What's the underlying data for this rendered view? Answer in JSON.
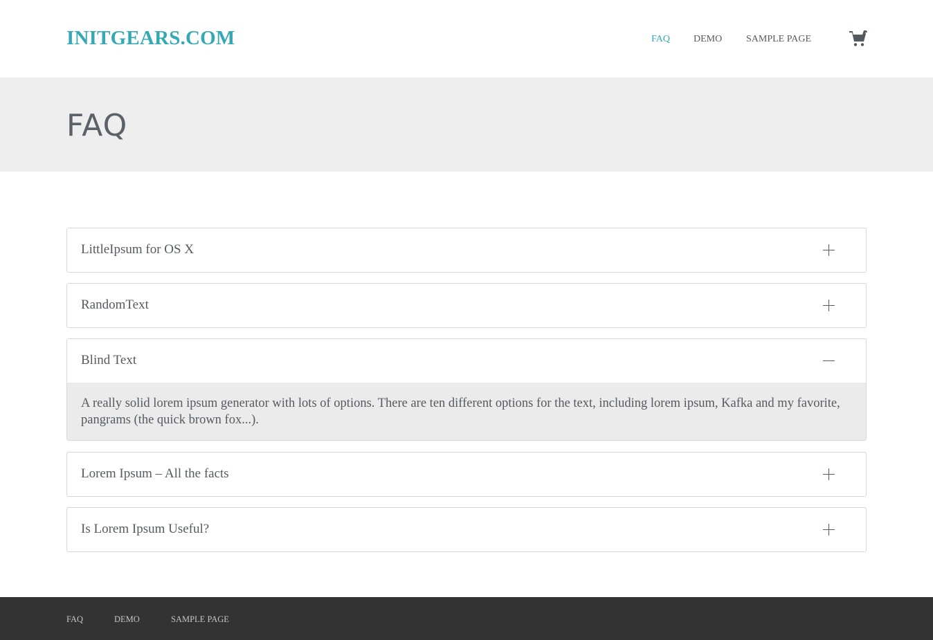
{
  "site": {
    "logo": "INITGEARS.COM"
  },
  "nav": {
    "items": [
      {
        "label": "FAQ",
        "active": true
      },
      {
        "label": "DEMO",
        "active": false
      },
      {
        "label": "SAMPLE PAGE",
        "active": false
      }
    ],
    "cart_icon": "cart-icon"
  },
  "hero": {
    "title": "FAQ"
  },
  "faq": {
    "items": [
      {
        "question": "LittleIpsum for OS X",
        "expanded": false,
        "icon": "plus-icon"
      },
      {
        "question": "RandomText",
        "expanded": false,
        "icon": "plus-icon"
      },
      {
        "question": "Blind Text",
        "expanded": true,
        "icon": "minus-icon",
        "answer": "A really solid lorem ipsum generator with lots of options. There are ten different options for the text, including lorem ipsum, Kafka and my favorite, pangrams (the quick brown fox...)."
      },
      {
        "question": "Lorem Ipsum – All the facts",
        "expanded": false,
        "icon": "plus-icon"
      },
      {
        "question": "Is Lorem Ipsum Useful?",
        "expanded": false,
        "icon": "plus-icon"
      }
    ]
  },
  "footer": {
    "links": [
      {
        "label": "FAQ"
      },
      {
        "label": "DEMO"
      },
      {
        "label": "SAMPLE PAGE"
      }
    ]
  },
  "colors": {
    "accent": "#35a8b5",
    "text": "#555a60",
    "hero_bg": "#eeeeee",
    "footer_bg": "#333333",
    "answer_bg": "#ebebeb"
  }
}
